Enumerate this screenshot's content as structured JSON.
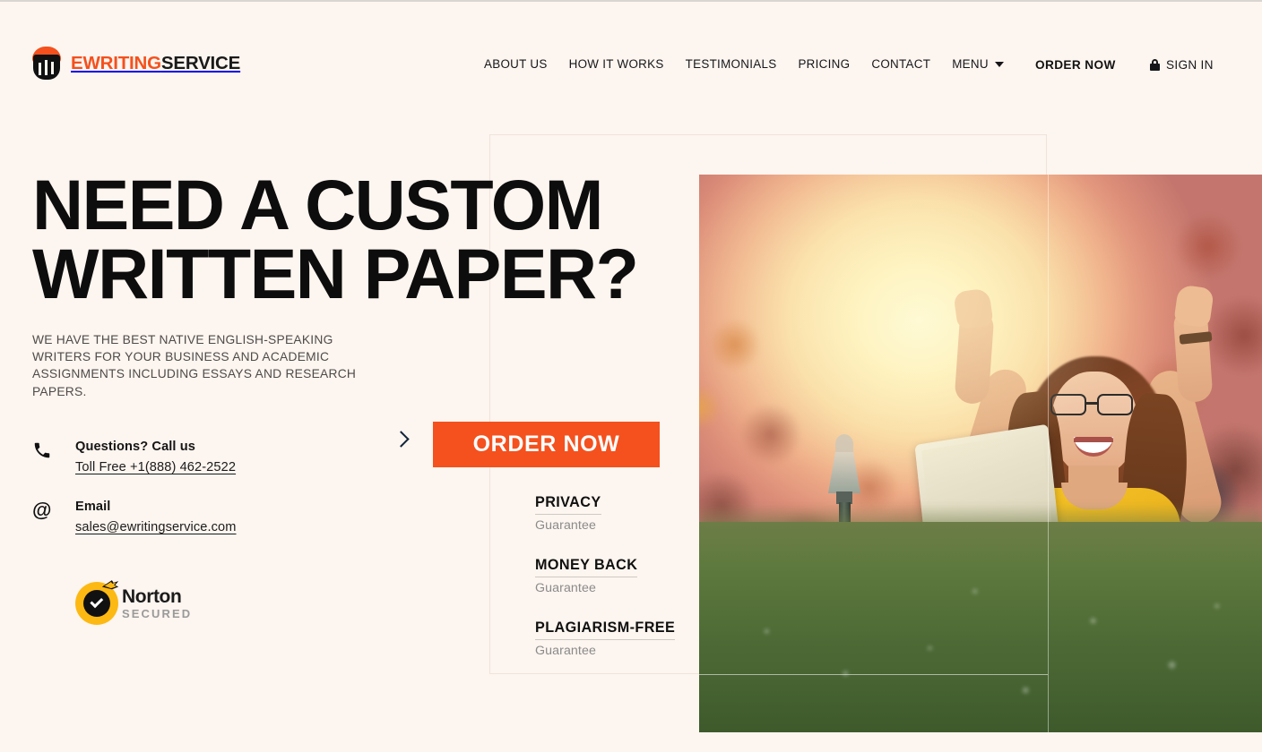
{
  "brand": {
    "logo_icon": "cup-swoosh-logo-icon",
    "name_part1": "EWRITING",
    "name_part2": "SERVICE",
    "accent_color": "#f4511e"
  },
  "nav": {
    "items": [
      {
        "label": "ABOUT US",
        "name": "about-us"
      },
      {
        "label": "HOW IT WORKS",
        "name": "how-it-works"
      },
      {
        "label": "TESTIMONIALS",
        "name": "testimonials"
      },
      {
        "label": "PRICING",
        "name": "pricing"
      },
      {
        "label": "CONTACT",
        "name": "contact"
      }
    ],
    "menu_label": "MENU",
    "menu_caret_icon": "chevron-down-icon",
    "order_now_label": "ORDER NOW",
    "sign_in_label": "SIGN IN",
    "sign_in_icon": "lock-icon"
  },
  "hero": {
    "headline_line1": "NEED A CUSTOM",
    "headline_line2": "WRITTEN PAPER?",
    "subcopy": "WE HAVE THE BEST NATIVE ENGLISH-SPEAKING WRITERS FOR YOUR BUSINESS AND ACADEMIC ASSIGNMENTS INCLUDING ESSAYS AND RESEARCH PAPERS.",
    "image_alt": "woman celebrating with laptop on grass in autumn park"
  },
  "contact": {
    "phone": {
      "icon": "phone-icon",
      "title": "Questions? Call us",
      "value": "Toll Free +1(888) 462-2522"
    },
    "email": {
      "icon": "at-sign-icon",
      "title": "Email",
      "value": "sales@ewritingservice.com"
    }
  },
  "norton": {
    "icon": "norton-checkmark-icon",
    "line1": "Norton",
    "line2": "SECURED",
    "ring_color": "#fdb913"
  },
  "cta": {
    "arrow_icon": "chevron-right-icon",
    "button_label": "ORDER NOW",
    "button_color": "#f4511e"
  },
  "guarantees": [
    {
      "title": "PRIVACY",
      "subtitle": "Guarantee"
    },
    {
      "title": "MONEY BACK",
      "subtitle": "Guarantee"
    },
    {
      "title": "PLAGIARISM-FREE",
      "subtitle": "Guarantee"
    }
  ],
  "theme": {
    "background": "#fdf5ef",
    "text": "#16161a",
    "muted": "#8b8b8b"
  }
}
